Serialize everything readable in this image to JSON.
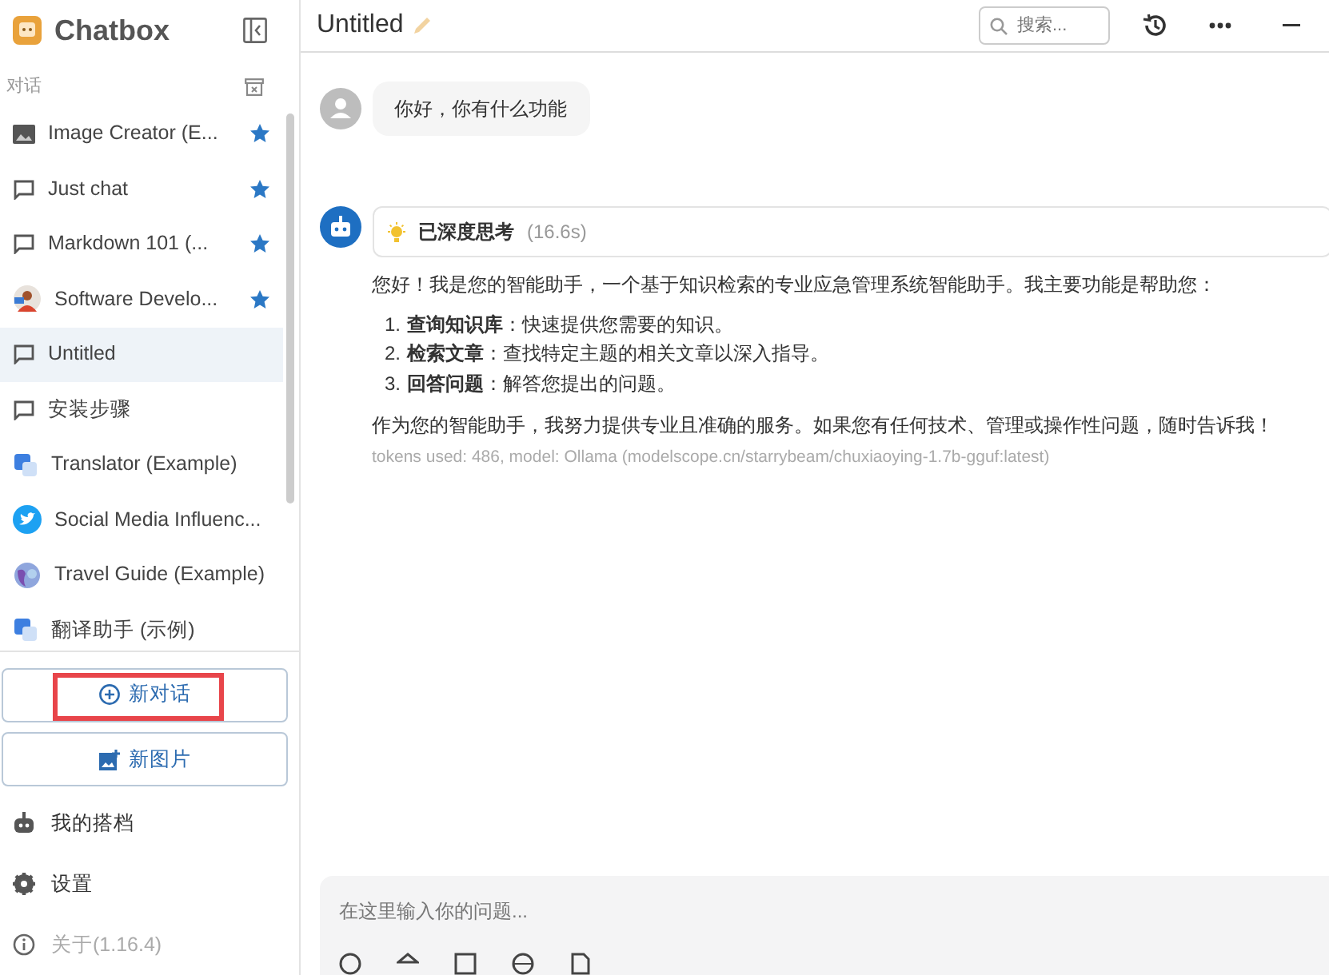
{
  "sidebar": {
    "app_title": "Chatbox",
    "section_label": "对话",
    "conversations": [
      {
        "title": "Image Creator (E...",
        "kind": "image",
        "starred": true,
        "selected": false
      },
      {
        "title": "Just chat",
        "kind": "chat",
        "starred": true,
        "selected": false
      },
      {
        "title": "Markdown 101 (...",
        "kind": "chat",
        "starred": true,
        "selected": false
      },
      {
        "title": "Software Develo...",
        "kind": "avatar",
        "starred": true,
        "selected": false
      },
      {
        "title": "Untitled",
        "kind": "chat",
        "starred": false,
        "selected": true
      },
      {
        "title": "安装步骤",
        "kind": "chat",
        "starred": false,
        "selected": false
      },
      {
        "title": "Translator (Example)",
        "kind": "translate",
        "starred": false,
        "selected": false
      },
      {
        "title": "Social Media Influenc...",
        "kind": "bird",
        "starred": false,
        "selected": false
      },
      {
        "title": "Travel Guide (Example)",
        "kind": "globe",
        "starred": false,
        "selected": false
      },
      {
        "title": "翻译助手 (示例)",
        "kind": "translate",
        "starred": false,
        "selected": false
      }
    ],
    "actions": [
      {
        "label": "新对话",
        "kind": "chat",
        "highlighted": true
      },
      {
        "label": "新图片",
        "kind": "image",
        "highlighted": false
      }
    ],
    "menu": [
      {
        "label": "我的搭档",
        "kind": "bot",
        "muted": false
      },
      {
        "label": "设置",
        "kind": "gear",
        "muted": false
      },
      {
        "label": "关于(1.16.4)",
        "kind": "info",
        "muted": true
      }
    ]
  },
  "header": {
    "title": "Untitled",
    "search": {
      "placeholder": "搜索..."
    }
  },
  "messages": [
    {
      "kind": "user",
      "text": "你好，你有什么功能"
    },
    {
      "kind": "assistant",
      "thinking": {
        "label": "已深度思考",
        "time": "(16.6s)"
      },
      "paragraphs": [
        "您好！我是您的智能助手，一个基于知识检索的专业应急管理系统智能助手。我主要功能是帮助您："
      ],
      "list": [
        {
          "marker": "1.",
          "text": "**查询知识库**：快速提供您需要的知识。"
        },
        {
          "marker": "2.",
          "text": "**检索文章**：查找特定主题的相关文章以深入指导。"
        },
        {
          "marker": "3.",
          "text": "**回答问题**：解答您提出的问题。"
        }
      ],
      "closing": "作为您的智能助手，我努力提供专业且准确的服务。如果您有任何技术、管理或操作性问题，随时告诉我！",
      "meta": "tokens used: 486, model: Ollama (modelscope.cn/starrybeam/chuxiaoying-1.7b-gguf:latest)"
    }
  ],
  "composer": {
    "placeholder": "在这里输入你的问题..."
  }
}
